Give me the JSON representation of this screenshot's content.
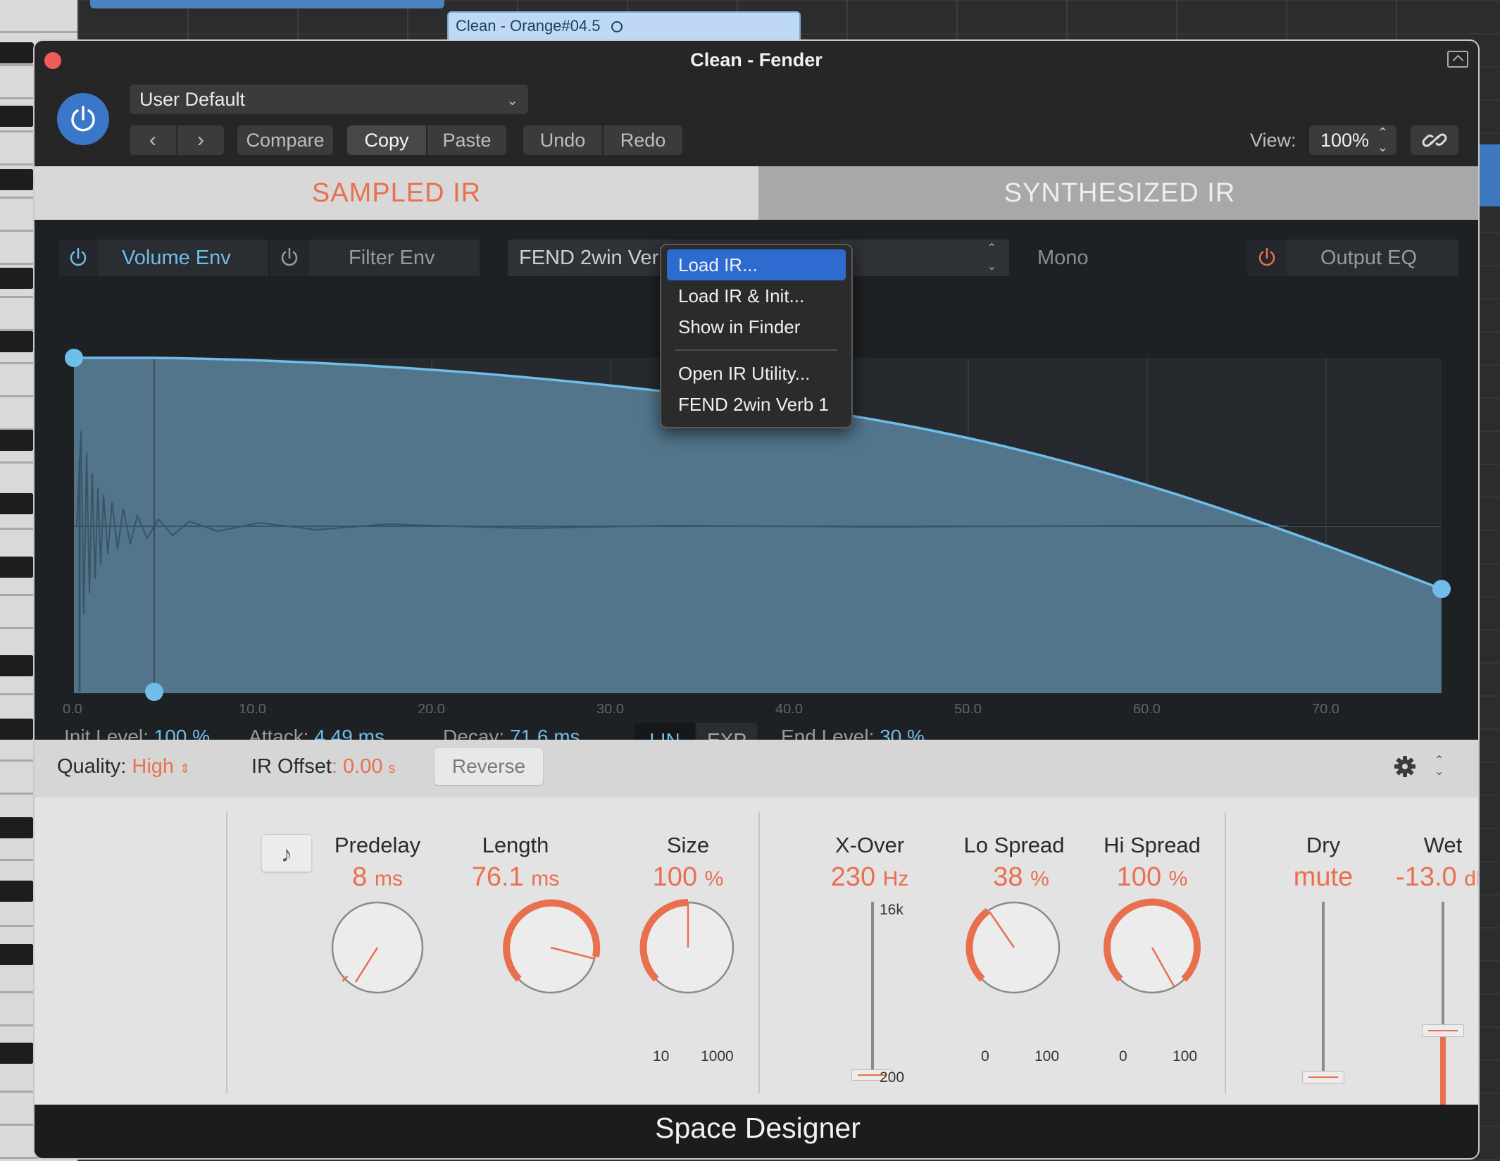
{
  "daw": {
    "region_label": "Clean - Orange#04.5"
  },
  "window": {
    "title": "Clean - Fender",
    "footer_title": "Space Designer"
  },
  "toolbar": {
    "preset": "User Default",
    "prev_label": "‹",
    "next_label": "›",
    "compare_label": "Compare",
    "copy_label": "Copy",
    "paste_label": "Paste",
    "undo_label": "Undo",
    "redo_label": "Redo",
    "view_label": "View:",
    "view_value": "100%"
  },
  "tabs": {
    "sampled": "SAMPLED IR",
    "synthesized": "SYNTHESIZED IR"
  },
  "envelope": {
    "volume_env": "Volume Env",
    "filter_env": "Filter Env",
    "ir_name": "FEND 2win Ver",
    "mono": "Mono",
    "output_eq": "Output EQ",
    "axis_ticks": [
      "0.0",
      "10.0",
      "20.0",
      "30.0",
      "40.0",
      "50.0",
      "60.0",
      "70.0"
    ],
    "init_level_label": "Init Level:",
    "init_level_value": "100 %",
    "attack_label": "Attack:",
    "attack_value": "4.49 ms",
    "decay_label": "Decay:",
    "decay_value": "71.6 ms",
    "lin": "LIN",
    "exp": "EXP",
    "end_level_label": "End Level:",
    "end_level_value": "30 %"
  },
  "menu": {
    "items": [
      "Load IR...",
      "Load IR & Init...",
      "Show in Finder",
      "Open IR Utility...",
      "FEND 2win Verb 1"
    ],
    "selected_index": 0
  },
  "quality": {
    "quality_label": "Quality:",
    "quality_value": "High",
    "offset_label": "IR Offset",
    "offset_value": ": 0.00",
    "offset_unit": "s",
    "reverse_label": "Reverse"
  },
  "controls": {
    "predelay": {
      "title": "Predelay",
      "value": "8",
      "unit": "ms"
    },
    "length": {
      "title": "Length",
      "value": "76.1",
      "unit": "ms"
    },
    "size": {
      "title": "Size",
      "value": "100",
      "unit": "%",
      "min": "10",
      "max": "1000"
    },
    "xover": {
      "title": "X-Over",
      "value": "230",
      "unit": "Hz",
      "top": "16k",
      "bottom": "200"
    },
    "lo_spread": {
      "title": "Lo Spread",
      "value": "38",
      "unit": "%",
      "min": "0",
      "max": "100"
    },
    "hi_spread": {
      "title": "Hi Spread",
      "value": "100",
      "unit": "%",
      "min": "0",
      "max": "100"
    },
    "dry": {
      "title": "Dry",
      "value": "mute"
    },
    "wet": {
      "title": "Wet",
      "value": "-13.0",
      "unit": "dB"
    }
  },
  "colors": {
    "accent": "#e9704f",
    "envelope_blue": "#6fbde9",
    "power_blue": "#3a77c9"
  },
  "icons": {
    "power": "power-icon",
    "link": "link-icon",
    "gear": "gear-icon",
    "note": "music-note-icon"
  }
}
